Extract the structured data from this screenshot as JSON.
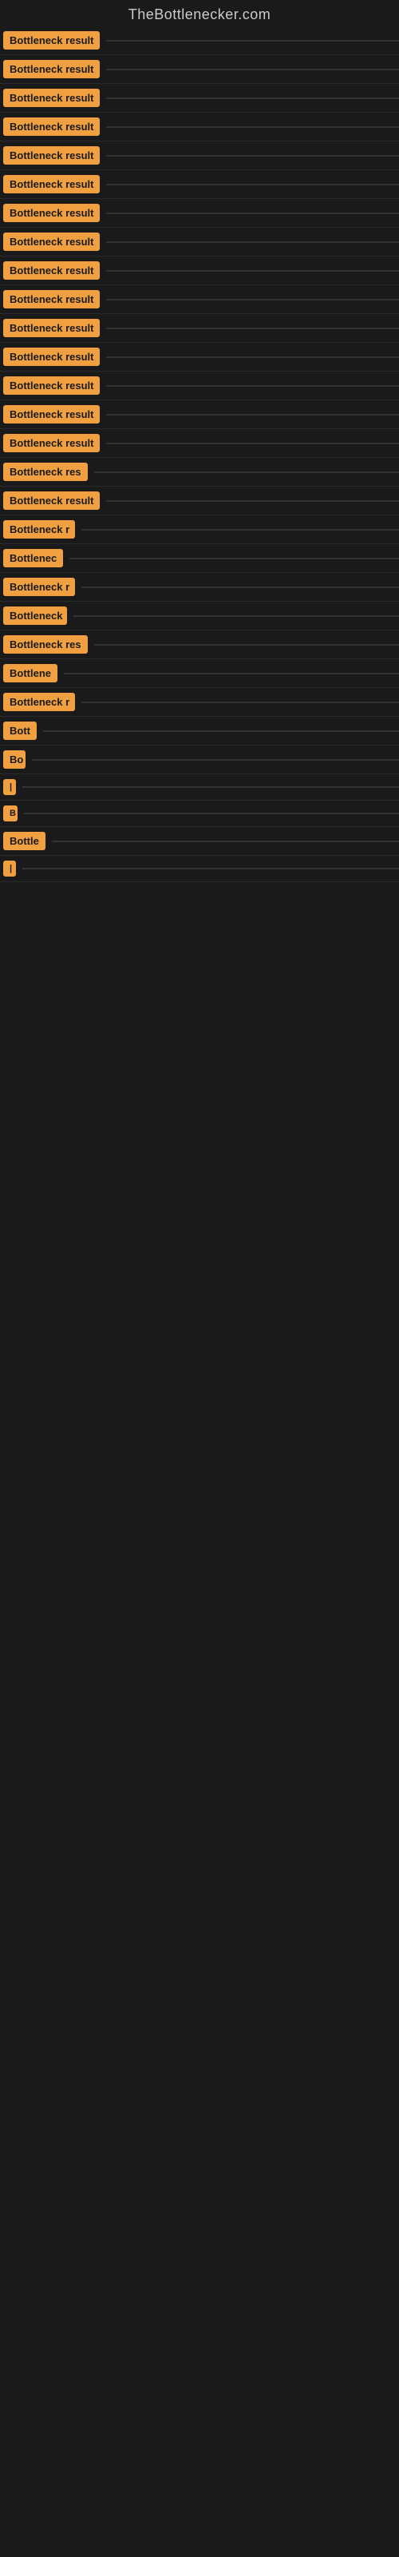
{
  "site": {
    "title": "TheBottlenecker.com"
  },
  "results": [
    {
      "label": "Bottleneck result",
      "badge_width": 130
    },
    {
      "label": "Bottleneck result",
      "badge_width": 130
    },
    {
      "label": "Bottleneck result",
      "badge_width": 130
    },
    {
      "label": "Bottleneck result",
      "badge_width": 130
    },
    {
      "label": "Bottleneck result",
      "badge_width": 130
    },
    {
      "label": "Bottleneck result",
      "badge_width": 130
    },
    {
      "label": "Bottleneck result",
      "badge_width": 130
    },
    {
      "label": "Bottleneck result",
      "badge_width": 130
    },
    {
      "label": "Bottleneck result",
      "badge_width": 130
    },
    {
      "label": "Bottleneck result",
      "badge_width": 130
    },
    {
      "label": "Bottleneck result",
      "badge_width": 130
    },
    {
      "label": "Bottleneck result",
      "badge_width": 130
    },
    {
      "label": "Bottleneck result",
      "badge_width": 130
    },
    {
      "label": "Bottleneck result",
      "badge_width": 130
    },
    {
      "label": "Bottleneck result",
      "badge_width": 130
    },
    {
      "label": "Bottleneck res",
      "badge_width": 110
    },
    {
      "label": "Bottleneck result",
      "badge_width": 130
    },
    {
      "label": "Bottleneck r",
      "badge_width": 90
    },
    {
      "label": "Bottlenec",
      "badge_width": 75
    },
    {
      "label": "Bottleneck r",
      "badge_width": 90
    },
    {
      "label": "Bottleneck",
      "badge_width": 80
    },
    {
      "label": "Bottleneck res",
      "badge_width": 110
    },
    {
      "label": "Bottlene",
      "badge_width": 70
    },
    {
      "label": "Bottleneck r",
      "badge_width": 90
    },
    {
      "label": "Bott",
      "badge_width": 45
    },
    {
      "label": "Bo",
      "badge_width": 28
    },
    {
      "label": "|",
      "badge_width": 14
    },
    {
      "label": "B",
      "badge_width": 18
    },
    {
      "label": "Bottle",
      "badge_width": 55
    },
    {
      "label": "|",
      "badge_width": 14
    }
  ]
}
